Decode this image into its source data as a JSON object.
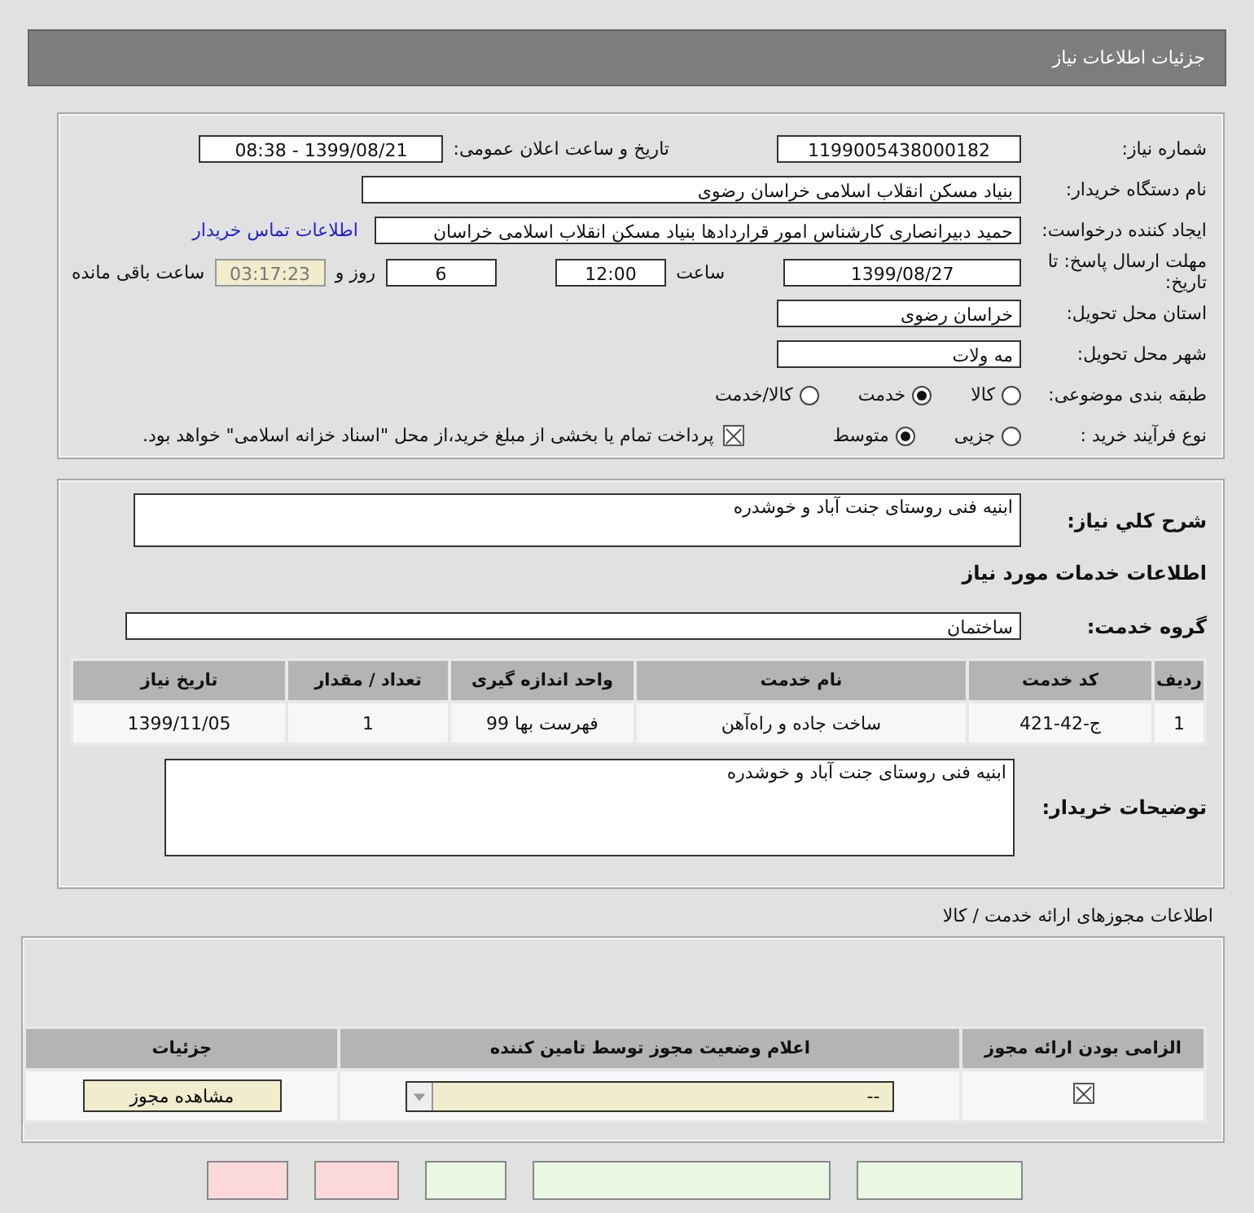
{
  "header": {
    "title": "جزئیات اطلاعات نیاز"
  },
  "need": {
    "number_label": "شماره نیاز:",
    "number": "1199005438000182",
    "announce_label": "تاریخ و ساعت اعلان عمومی:",
    "announce": "1399/08/21 - 08:38",
    "buyer_label": "نام دستگاه خریدار:",
    "buyer": "بنیاد مسکن انقلاب اسلامی خراسان رضوی",
    "creator_label": "ایجاد کننده درخواست:",
    "creator": "حمید دبیرانصاری کارشناس امور قراردادها بنیاد مسکن انقلاب اسلامی خراسان",
    "contact_link": "اطلاعات تماس خریدار",
    "deadline_label": "مهلت ارسال پاسخ: تا تاریخ:",
    "deadline_date": "1399/08/27",
    "hour_label": "ساعت",
    "deadline_time": "12:00",
    "days": "6",
    "days_label": "روز و",
    "remaining": "03:17:23",
    "remaining_label": "ساعت باقی مانده",
    "province_label": "استان محل تحویل:",
    "province": "خراسان رضوی",
    "city_label": "شهر محل تحویل:",
    "city": "مه ولات",
    "category_label": "طبقه بندی موضوعی:",
    "category_options": [
      {
        "label": "کالا",
        "selected": false
      },
      {
        "label": "خدمت",
        "selected": true
      },
      {
        "label": "کالا/خدمت",
        "selected": false
      }
    ],
    "process_label": "نوع فرآیند خرید :",
    "process_options": [
      {
        "label": "جزیی",
        "selected": false
      },
      {
        "label": "متوسط",
        "selected": true
      }
    ],
    "payment": {
      "checked": true,
      "text": "پرداخت تمام یا بخشی از مبلغ خرید،از محل \"اسناد خزانه اسلامی\" خواهد بود."
    }
  },
  "details": {
    "summary_label": "شرح کلي نياز:",
    "summary": "ابنیه فنی روستای جنت آباد و خوشدره",
    "section_title": "اطلاعات خدمات مورد نياز",
    "group_label": "گروه خدمت:",
    "group": "ساختمان",
    "table": {
      "columns": [
        "ردیف",
        "کد خدمت",
        "نام خدمت",
        "واحد اندازه گیری",
        "تعداد / مقدار",
        "تاریخ نیاز"
      ],
      "rows": [
        [
          "1",
          "ج-42-421",
          "ساخت جاده و راه‌آهن",
          "فهرست بها 99",
          "1",
          "1399/11/05"
        ]
      ]
    },
    "notes_label": "توضیحات خریدار:",
    "notes": "ابنیه فنی روستای جنت آباد و خوشدره"
  },
  "licenses": {
    "title": "اطلاعات مجوزهای ارائه خدمت / کالا",
    "columns": [
      "الزامی بودن ارائه مجوز",
      "اعلام وضعیت مجوز توسط تامین کننده",
      "جزئیات"
    ],
    "rows": [
      {
        "required": true,
        "status": "--",
        "button": "مشاهده مجوز"
      }
    ]
  },
  "bottom_buttons": [
    {
      "color": "#e9f7e3"
    },
    {
      "color": "#e9f7e3"
    },
    {
      "color": "#e9f7e3"
    },
    {
      "color": "#fbd9d9"
    },
    {
      "color": "#fbd9d9"
    }
  ]
}
